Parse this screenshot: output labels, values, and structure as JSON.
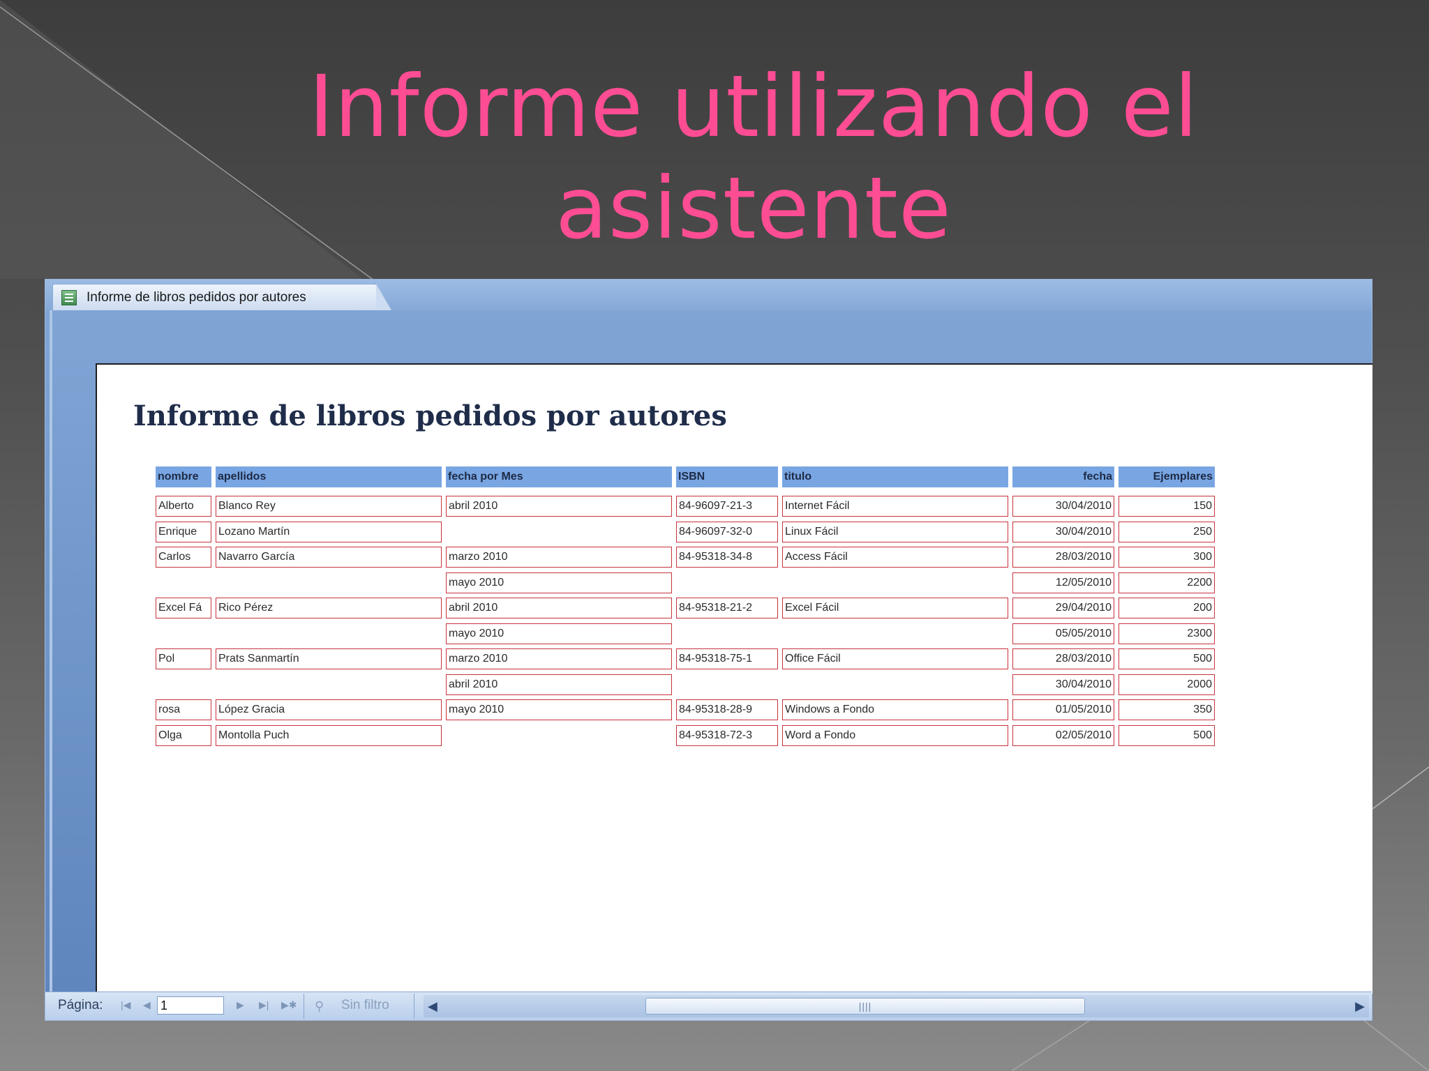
{
  "slide": {
    "title_line1": "Informe utilizando el",
    "title_line2": "asistente",
    "title_color": "#ff4d94"
  },
  "window": {
    "tab_label": "Informe de libros pedidos por autores",
    "tab_icon": "report-icon"
  },
  "report": {
    "title": "Informe de libros pedidos por autores",
    "headers": {
      "nombre": "nombre",
      "apellidos": "apellidos",
      "mes": "fecha por Mes",
      "isbn": "ISBN",
      "titulo": "titulo",
      "fecha": "fecha",
      "ejemplares": "Ejemplares"
    },
    "rows": [
      {
        "nombre": "Alberto",
        "apellidos": "Blanco Rey",
        "mes": "abril 2010",
        "isbn": "84-96097-21-3",
        "titulo": "Internet Fácil",
        "fecha": "30/04/2010",
        "ejemplares": "150"
      },
      {
        "nombre": "Enrique",
        "apellidos": "Lozano Martín",
        "mes": "",
        "isbn": "84-96097-32-0",
        "titulo": "Linux Fácil",
        "fecha": "30/04/2010",
        "ejemplares": "250"
      },
      {
        "nombre": "Carlos",
        "apellidos": "Navarro García",
        "mes": "marzo 2010",
        "isbn": "84-95318-34-8",
        "titulo": "Access Fácil",
        "fecha": "28/03/2010",
        "ejemplares": "300"
      },
      {
        "nombre": "",
        "apellidos": "",
        "mes": "mayo 2010",
        "isbn": "",
        "titulo": "",
        "fecha": "12/05/2010",
        "ejemplares": "2200"
      },
      {
        "nombre": "Excel Fá",
        "apellidos": "Rico Pérez",
        "mes": "abril 2010",
        "isbn": "84-95318-21-2",
        "titulo": "Excel Fácil",
        "fecha": "29/04/2010",
        "ejemplares": "200"
      },
      {
        "nombre": "",
        "apellidos": "",
        "mes": "mayo 2010",
        "isbn": "",
        "titulo": "",
        "fecha": "05/05/2010",
        "ejemplares": "2300"
      },
      {
        "nombre": "Pol",
        "apellidos": "Prats Sanmartín",
        "mes": "marzo 2010",
        "isbn": "84-95318-75-1",
        "titulo": "Office Fácil",
        "fecha": "28/03/2010",
        "ejemplares": "500"
      },
      {
        "nombre": "",
        "apellidos": "",
        "mes": "abril 2010",
        "isbn": "",
        "titulo": "",
        "fecha": "30/04/2010",
        "ejemplares": "2000"
      },
      {
        "nombre": "rosa",
        "apellidos": "López Gracia",
        "mes": "mayo 2010",
        "isbn": "84-95318-28-9",
        "titulo": "Windows a Fondo",
        "fecha": "01/05/2010",
        "ejemplares": "350"
      },
      {
        "nombre": "Olga",
        "apellidos": "Montolla Puch",
        "mes": "",
        "isbn": "84-95318-72-3",
        "titulo": "Word a Fondo",
        "fecha": "02/05/2010",
        "ejemplares": "500"
      }
    ]
  },
  "statusbar": {
    "page_label": "Página:",
    "page_value": "1",
    "filter_label": "Sin filtro",
    "scroll_grip": "||||"
  },
  "colors": {
    "header_fill": "#79a6e3",
    "cell_border": "#c8323c",
    "report_title": "#1f2d4a"
  }
}
